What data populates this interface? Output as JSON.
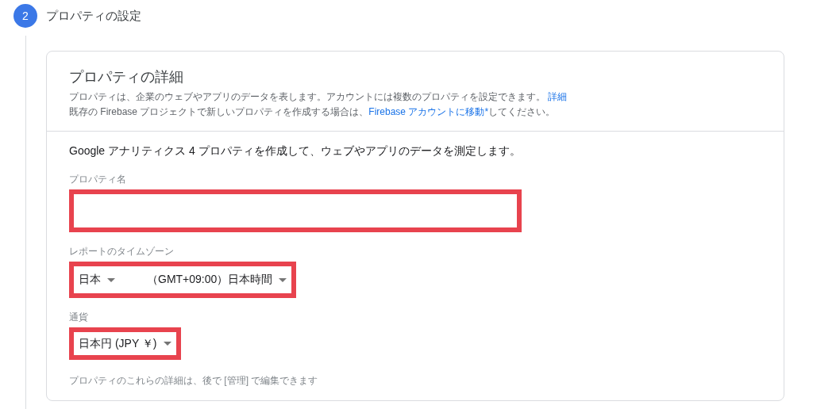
{
  "step": {
    "number": "2",
    "title": "プロパティの設定"
  },
  "card": {
    "title": "プロパティの詳細",
    "description": [
      [
        {
          "kind": "text",
          "text": "プロパティは、企業のウェブやアプリのデータを表します。アカウントには複数のプロパティを設定できます。 "
        },
        {
          "kind": "link",
          "text": "詳細"
        }
      ],
      [
        {
          "kind": "text",
          "text": "既存の Firebase プロジェクトで新しいプロパティを作成する場合は、"
        },
        {
          "kind": "link",
          "text": "Firebase アカウントに移動*"
        },
        {
          "kind": "text",
          "text": "してください。"
        }
      ]
    ],
    "intro": "Google アナリティクス 4 プロパティを作成して、ウェブやアプリのデータを測定します。",
    "fields": [
      {
        "kind": "input",
        "label": "プロパティ名",
        "highlighted": true
      },
      {
        "kind": "selects",
        "label": "レポートのタイムゾーン",
        "highlighted": true,
        "options": [
          "日本",
          "（GMT+09:00）日本時間"
        ]
      },
      {
        "kind": "selects",
        "label": "通貨",
        "highlighted": true,
        "options": [
          "日本円 (JPY ￥)"
        ]
      }
    ],
    "note": "プロパティのこれらの詳細は、後で [管理] で編集できます"
  }
}
